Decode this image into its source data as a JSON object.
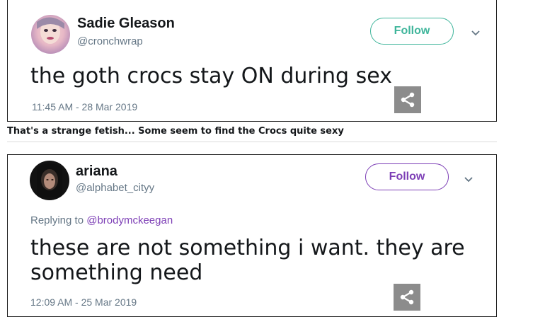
{
  "tweets": [
    {
      "name": "Sadie Gleason",
      "handle": "@cronchwrap",
      "follow_label": "Follow",
      "text": "the goth crocs stay ON during sex",
      "timestamp": "11:45 AM - 28 Mar 2019",
      "follow_color": "#3fb59b"
    },
    {
      "name": "ariana",
      "handle": "@alphabet_cityy",
      "follow_label": "Follow",
      "reply_prefix": "Replying to",
      "reply_mention": "@brodymckeegan",
      "text_line1": "these are not something i want. they are",
      "text_line2": "something need",
      "timestamp": "12:09 AM - 25 Mar 2019",
      "follow_color": "#7d3fb6"
    }
  ],
  "caption": "That's a strange fetish... Some seem to find the Crocs quite sexy",
  "icons": [
    "chevron-down-icon",
    "share-icon"
  ]
}
